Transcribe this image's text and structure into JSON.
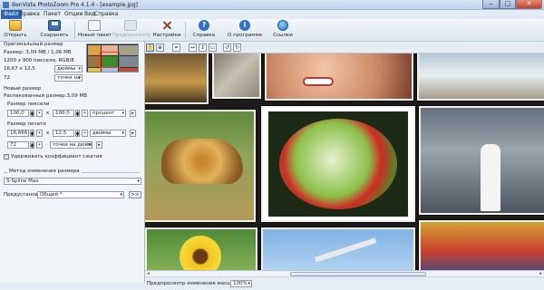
{
  "window": {
    "title": "BenVista PhotoZoom Pro 4.1.4 - [example.jpg]",
    "controls": {
      "minimize": "‒",
      "maximize": "□",
      "close": "✕"
    }
  },
  "menu": [
    "Файл",
    "Правка",
    "Пакет",
    "Опции",
    "Вид",
    "Справка"
  ],
  "toolbar": {
    "open": "Открыть",
    "save": "Сохранить",
    "new_batch": "Новый пакет",
    "preview": "Предпросмотр",
    "settings": "Настройки",
    "help": "Справка",
    "about": "О программе",
    "links": "Ссылки"
  },
  "original": {
    "heading": "Оригинальный размер",
    "size_line": "Размер: 3,09 MB / 1,06 MB",
    "pixels_line": "1200 x 900 пиксели, RGB/8",
    "dims": "16,67 x 12,5",
    "dims_unit": "дюймы",
    "res": "72",
    "res_unit": "точки на дюйм"
  },
  "new_size": {
    "heading": "Новый размер",
    "uncompressed": "Распакованный размер:3,09 MB",
    "pixel_heading": "Размер пиксели",
    "pixel_w": "100,0",
    "x_sep": "x",
    "pixel_h": "100,0",
    "pixel_unit": "процент",
    "print_heading": "Размер печати",
    "print_w": "16,6667",
    "print_h": "12,5",
    "print_unit": "дюймы",
    "res": "72",
    "res_unit": "точки на дюйм",
    "keep_ratio_label": "Удерживать коэффициент сжатия",
    "link_symbol": "•",
    "more_symbol": "▸"
  },
  "method": {
    "heading": "Метод изменения размера",
    "value": "S-Spline Max",
    "preset_label": "Предустановка:",
    "preset_value": "Общий *",
    "btn_prev": "> ",
    "btn_next": ">>"
  },
  "status": {
    "zoom_label": "Предпросмотр изменения масштаба:",
    "zoom_value": "100%"
  },
  "colors": {
    "accent": "#2b63b7",
    "panel": "#f1f4f8"
  },
  "icons": {
    "open": "folder-icon",
    "save": "floppy-icon",
    "new_batch": "batch-icon",
    "preview": "preview-icon",
    "settings": "tools-icon",
    "help": "question-icon",
    "about": "info-icon",
    "links": "globe-icon"
  }
}
